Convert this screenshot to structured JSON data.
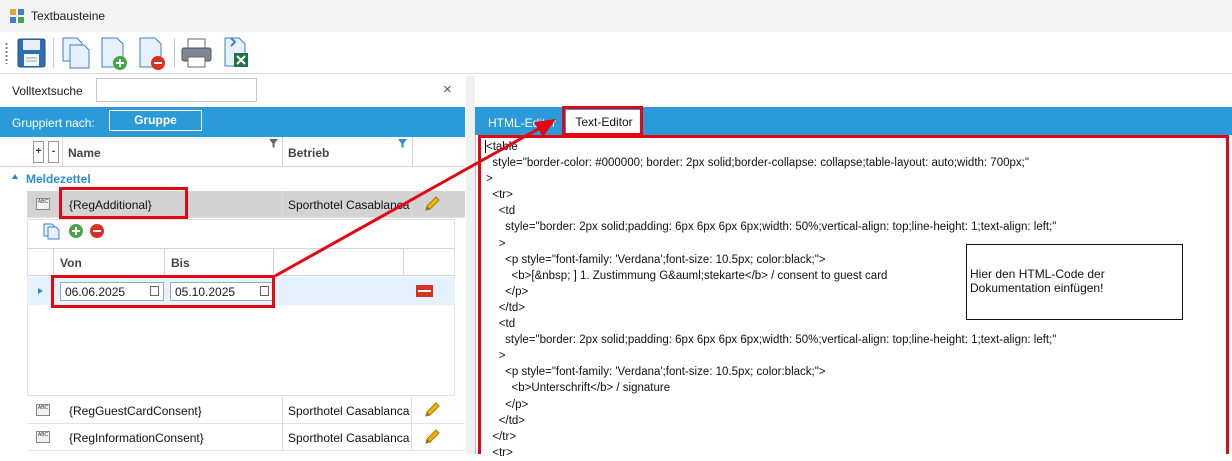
{
  "window": {
    "title": "Textbausteine"
  },
  "search": {
    "label": "Volltextsuche",
    "value": "",
    "clear": "×"
  },
  "group_by": {
    "label": "Gruppiert nach:",
    "chip": "Gruppe"
  },
  "grid": {
    "expand": "+",
    "collapse": "-",
    "columns": {
      "name": "Name",
      "betrieb": "Betrieb"
    },
    "group_title": "Meldezettel",
    "type_glyph": "ABC",
    "rows": [
      {
        "name": "{RegAdditional}",
        "betrieb": "Sporthotel Casablanca"
      },
      {
        "name": "{RegGuestCardConsent}",
        "betrieb": "Sporthotel Casablanca'"
      },
      {
        "name": "{RegInformationConsent}",
        "betrieb": "Sporthotel Casablanca'"
      }
    ]
  },
  "detail": {
    "columns": {
      "von": "Von",
      "bis": "Bis"
    },
    "row": {
      "von": "06.06.2025",
      "bis": "05.10.2025"
    }
  },
  "tabs": {
    "html_editor": "HTML-Editor",
    "text_editor": "Text-Editor"
  },
  "editor": {
    "content": "<table\n  style=\"border-color: #000000; border: 2px solid;border-collapse: collapse;table-layout: auto;width: 700px;\"\n>\n  <tr>\n    <td\n      style=\"border: 2px solid;padding: 6px 6px 6px 6px;width: 50%;vertical-align: top;line-height: 1;text-align: left;\"\n    >\n      <p style=\"font-family: 'Verdana';font-size: 10.5px; color:black;\">\n        <b>[&nbsp; ] 1. Zustimmung G&auml;stekarte</b> / consent to guest card\n      </p>\n    </td>\n    <td\n      style=\"border: 2px solid;padding: 6px 6px 6px 6px;width: 50%;vertical-align: top;line-height: 1;text-align: left;\"\n    >\n      <p style=\"font-family: 'Verdana';font-size: 10.5px; color:black;\">\n        <b>Unterschrift</b> / signature\n      </p>\n    </td>\n  </tr>\n  <tr>"
  },
  "note": {
    "text": "Hier den HTML-Code der Dokumentation einfügen!"
  },
  "colors": {
    "accent": "#2a9bd8",
    "annotation": "#e30613"
  },
  "icons": [
    "save-icon",
    "copy-icon",
    "new-document-icon",
    "delete-document-icon",
    "print-icon",
    "excel-export-icon",
    "edit-pencil-icon",
    "add-icon",
    "remove-icon",
    "calendar-icon"
  ]
}
